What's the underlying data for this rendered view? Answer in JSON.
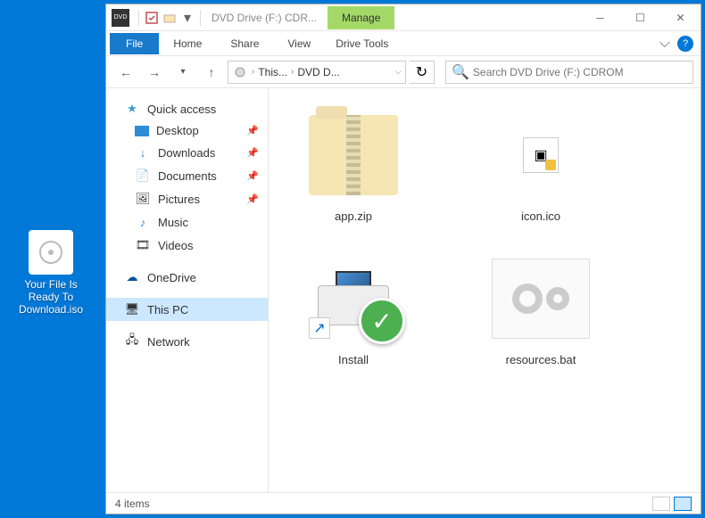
{
  "desktop": {
    "file_label": "Your File Is Ready To Download.iso"
  },
  "titlebar": {
    "title": "DVD Drive (F:) CDR...",
    "manage": "Manage"
  },
  "ribbon": {
    "file": "File",
    "home": "Home",
    "share": "Share",
    "view": "View",
    "drive_tools": "Drive Tools"
  },
  "address": {
    "crumb1": "This...",
    "crumb2": "DVD D..."
  },
  "search": {
    "placeholder": "Search DVD Drive (F:) CDROM"
  },
  "sidebar": {
    "quick_access": "Quick access",
    "desktop": "Desktop",
    "downloads": "Downloads",
    "documents": "Documents",
    "pictures": "Pictures",
    "music": "Music",
    "videos": "Videos",
    "onedrive": "OneDrive",
    "this_pc": "This PC",
    "network": "Network"
  },
  "files": {
    "app_zip": "app.zip",
    "icon_ico": "icon.ico",
    "install": "Install",
    "resources_bat": "resources.bat"
  },
  "status": {
    "count": "4 items"
  }
}
